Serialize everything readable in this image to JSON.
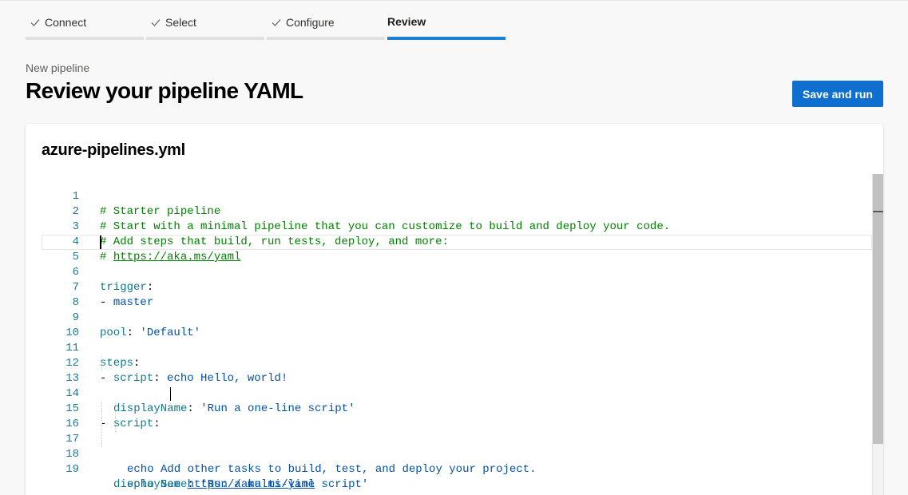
{
  "wizard": {
    "steps": [
      {
        "label": "Connect",
        "done": true
      },
      {
        "label": "Select",
        "done": true
      },
      {
        "label": "Configure",
        "done": true
      },
      {
        "label": "Review",
        "done": false,
        "active": true
      }
    ]
  },
  "header": {
    "breadcrumb": "New pipeline",
    "title": "Review your pipeline YAML",
    "save_run_label": "Save and run"
  },
  "editor": {
    "filename": "azure-pipelines.yml",
    "cursor_line": 5,
    "line_numbers": [
      "1",
      "2",
      "3",
      "4",
      "5",
      "6",
      "7",
      "8",
      "9",
      "10",
      "11",
      "12",
      "13",
      "14",
      "15",
      "16",
      "17",
      "18",
      "19"
    ],
    "lines": {
      "l1": "# Starter pipeline",
      "l2": "# Start with a minimal pipeline that you can customize to build and deploy your code.",
      "l3": "# Add steps that build, run tests, deploy, and more:",
      "l4_prefix": "# ",
      "l4_link": "https://aka.ms/yaml",
      "l6_key": "trigger",
      "l7_dash": "- ",
      "l7_val": "master",
      "l9_key": "pool",
      "l9_val": "'Default'",
      "l11_key": "steps",
      "l12_key": "script",
      "l12_val": "echo Hello, world!",
      "l13_key": "displayName",
      "l13_val": "'Run a one-line script'",
      "l15_key": "script",
      "l16_val": "echo Add other tasks to build, test, and deploy your project.",
      "l17_val": "echo See ",
      "l17_link": "https://aka.ms/yaml",
      "l18_key": "displayName",
      "l18_val": "'Run a multi-line script'"
    }
  },
  "colors": {
    "accent": "#0e6fcf",
    "comment": "#008000",
    "key": "#0e7a8b",
    "string": "#0451a5",
    "line_number": "#237893"
  },
  "icons": {
    "step_done": "checkmark-icon"
  }
}
